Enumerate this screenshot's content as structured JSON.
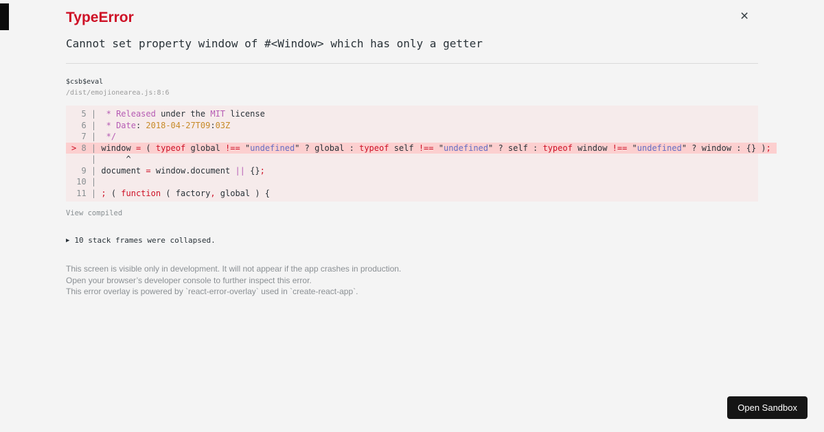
{
  "page": {
    "background": "#f4f4f4"
  },
  "header": {
    "title": "TypeError",
    "close": "×"
  },
  "error": {
    "message": "Cannot set property window of #<Window> which has only a getter"
  },
  "frame": {
    "function_name": "$csb$eval",
    "location": "/dist/emojionearea.js:8:6"
  },
  "code": {
    "background": "#f6ebeb",
    "highlight_background": "#fccfcf",
    "colors": {
      "pl": "#293238",
      "gy": "#878e91",
      "rd": "#ce1126",
      "pu": "#b65cb4",
      "or": "#c78a28",
      "bl": "#646ec3"
    },
    "lines": [
      {
        "h": false,
        "t": [
          [
            "gy",
            "  5 | "
          ],
          [
            "pl",
            " "
          ],
          [
            "pu",
            "*"
          ],
          [
            "pl",
            " "
          ],
          [
            "pu",
            "Released"
          ],
          [
            "pl",
            " under the "
          ],
          [
            "pu",
            "MIT"
          ],
          [
            "pl",
            " license"
          ]
        ]
      },
      {
        "h": false,
        "t": [
          [
            "gy",
            "  6 | "
          ],
          [
            "pl",
            " "
          ],
          [
            "pu",
            "*"
          ],
          [
            "pl",
            " "
          ],
          [
            "pu",
            "Date"
          ],
          [
            "pl",
            ": "
          ],
          [
            "or",
            "2018-04-27T09"
          ],
          [
            "pl",
            ":"
          ],
          [
            "or",
            "03Z"
          ]
        ]
      },
      {
        "h": false,
        "t": [
          [
            "gy",
            "  7 | "
          ],
          [
            "pl",
            " "
          ],
          [
            "pu",
            "*/"
          ]
        ]
      },
      {
        "h": true,
        "t": [
          [
            "rd",
            "> "
          ],
          [
            "gy",
            "8 | "
          ],
          [
            "pl",
            "window "
          ],
          [
            "rd",
            "="
          ],
          [
            "pl",
            " ( "
          ],
          [
            "rd",
            "typeof"
          ],
          [
            "pl",
            " global "
          ],
          [
            "rd",
            "!=="
          ],
          [
            "pl",
            " \""
          ],
          [
            "bl",
            "undefined"
          ],
          [
            "pl",
            "\" ? global : "
          ],
          [
            "rd",
            "typeof"
          ],
          [
            "pl",
            " self "
          ],
          [
            "rd",
            "!=="
          ],
          [
            "pl",
            " \""
          ],
          [
            "bl",
            "undefined"
          ],
          [
            "pl",
            "\" ? self : "
          ],
          [
            "rd",
            "typeof"
          ],
          [
            "pl",
            " window "
          ],
          [
            "rd",
            "!=="
          ],
          [
            "pl",
            " \""
          ],
          [
            "bl",
            "undefined"
          ],
          [
            "pl",
            "\" ? window : {} )"
          ],
          [
            "rd",
            ";"
          ]
        ]
      },
      {
        "h": false,
        "t": [
          [
            "gy",
            "    | "
          ],
          [
            "pl",
            "     ^"
          ]
        ]
      },
      {
        "h": false,
        "t": [
          [
            "gy",
            "  9 | "
          ],
          [
            "pl",
            "document "
          ],
          [
            "rd",
            "="
          ],
          [
            "pl",
            " window.document "
          ],
          [
            "pu",
            "||"
          ],
          [
            "pl",
            " {}"
          ],
          [
            "rd",
            ";"
          ]
        ]
      },
      {
        "h": false,
        "t": [
          [
            "gy",
            " 10 |"
          ]
        ]
      },
      {
        "h": false,
        "t": [
          [
            "gy",
            " 11 | "
          ],
          [
            "rd",
            ";"
          ],
          [
            "pl",
            " ( "
          ],
          [
            "rd",
            "function"
          ],
          [
            "pl",
            " ( factory"
          ],
          [
            "rd",
            ","
          ],
          [
            "pl",
            " global ) {"
          ]
        ]
      }
    ]
  },
  "actions": {
    "view_compiled": "View compiled"
  },
  "stack": {
    "arrow": "▶",
    "collapsed_text": "10 stack frames were collapsed."
  },
  "footer": {
    "lines": [
      "This screen is visible only in development. It will not appear if the app crashes in production.",
      "Open your browser’s developer console to further inspect this error.",
      "This error overlay is powered by `react-error-overlay` used in `create-react-app`."
    ]
  },
  "sandbox": {
    "label": "Open Sandbox",
    "background": "#151515",
    "color": "#ffffff"
  }
}
